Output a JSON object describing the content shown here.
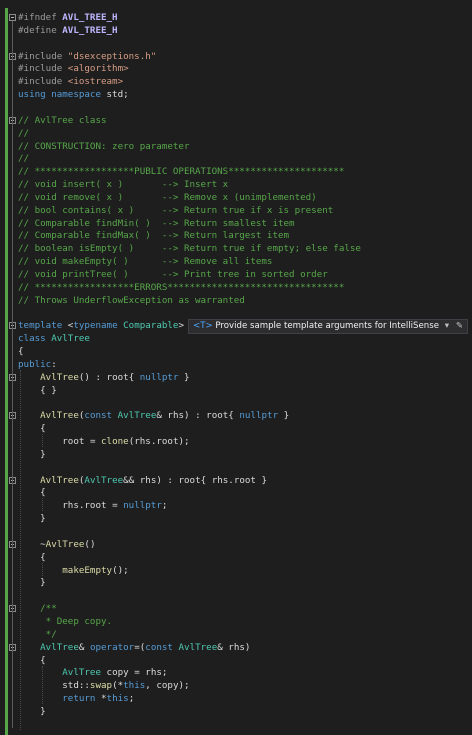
{
  "editor": {
    "lines": [
      {
        "segs": [
          [
            "pp",
            "#ifndef "
          ],
          [
            "macro",
            "AVL_TREE_H"
          ]
        ]
      },
      {
        "segs": [
          [
            "pp",
            "#define "
          ],
          [
            "macro",
            "AVL_TREE_H"
          ]
        ]
      },
      {
        "segs": []
      },
      {
        "segs": [
          [
            "pp",
            "#include "
          ],
          [
            "str",
            "\"dsexceptions.h\""
          ]
        ]
      },
      {
        "segs": [
          [
            "pp",
            "#include "
          ],
          [
            "str",
            "<algorithm>"
          ]
        ]
      },
      {
        "segs": [
          [
            "pp",
            "#include "
          ],
          [
            "str",
            "<iostream>"
          ]
        ]
      },
      {
        "segs": [
          [
            "kw",
            "using namespace "
          ],
          [
            "id",
            "std;"
          ]
        ]
      },
      {
        "segs": []
      },
      {
        "segs": [
          [
            "cm",
            "// AvlTree class"
          ]
        ]
      },
      {
        "segs": [
          [
            "cm",
            "//"
          ]
        ]
      },
      {
        "segs": [
          [
            "cm",
            "// CONSTRUCTION: zero parameter"
          ]
        ]
      },
      {
        "segs": [
          [
            "cm",
            "//"
          ]
        ]
      },
      {
        "segs": [
          [
            "cm",
            "// ******************PUBLIC OPERATIONS*********************"
          ]
        ]
      },
      {
        "segs": [
          [
            "cm",
            "// void insert( x )       --> Insert x"
          ]
        ]
      },
      {
        "segs": [
          [
            "cm",
            "// void remove( x )       --> Remove x (unimplemented)"
          ]
        ]
      },
      {
        "segs": [
          [
            "cm",
            "// bool contains( x )     --> Return true if x is present"
          ]
        ]
      },
      {
        "segs": [
          [
            "cm",
            "// Comparable findMin( )  --> Return smallest item"
          ]
        ]
      },
      {
        "segs": [
          [
            "cm",
            "// Comparable findMax( )  --> Return largest item"
          ]
        ]
      },
      {
        "segs": [
          [
            "cm",
            "// boolean isEmpty( )     --> Return true if empty; else false"
          ]
        ]
      },
      {
        "segs": [
          [
            "cm",
            "// void makeEmpty( )      --> Remove all items"
          ]
        ]
      },
      {
        "segs": [
          [
            "cm",
            "// void printTree( )      --> Print tree in sorted order"
          ]
        ]
      },
      {
        "segs": [
          [
            "cm",
            "// ******************ERRORS********************************"
          ]
        ]
      },
      {
        "segs": [
          [
            "cm",
            "// Throws UnderflowException as warranted"
          ]
        ]
      },
      {
        "segs": []
      },
      {
        "segs": [
          [
            "kw",
            "template "
          ],
          [
            "id",
            "<"
          ],
          [
            "kw",
            "typename "
          ],
          [
            "cls",
            "Comparable"
          ],
          [
            "id",
            ">"
          ]
        ]
      },
      {
        "segs": [
          [
            "kw",
            "class "
          ],
          [
            "cls",
            "AvlTree"
          ]
        ]
      },
      {
        "segs": [
          [
            "id",
            "{"
          ]
        ]
      },
      {
        "segs": [
          [
            "kw",
            "public"
          ],
          [
            "id",
            ":"
          ]
        ]
      },
      {
        "segs": [
          [
            "id",
            "    "
          ],
          [
            "fn",
            "AvlTree"
          ],
          [
            "id",
            "() : "
          ],
          [
            "fld",
            "root"
          ],
          [
            "id",
            "{ "
          ],
          [
            "kw",
            "nullptr"
          ],
          [
            "id",
            " }"
          ]
        ]
      },
      {
        "segs": [
          [
            "id",
            "    { }"
          ]
        ]
      },
      {
        "segs": []
      },
      {
        "segs": [
          [
            "id",
            "    "
          ],
          [
            "fn",
            "AvlTree"
          ],
          [
            "id",
            "("
          ],
          [
            "kw",
            "const "
          ],
          [
            "cls",
            "AvlTree"
          ],
          [
            "id",
            "& rhs) : "
          ],
          [
            "fld",
            "root"
          ],
          [
            "id",
            "{ "
          ],
          [
            "kw",
            "nullptr"
          ],
          [
            "id",
            " }"
          ]
        ]
      },
      {
        "segs": [
          [
            "id",
            "    {"
          ]
        ]
      },
      {
        "segs": [
          [
            "id",
            "        "
          ],
          [
            "fld",
            "root"
          ],
          [
            "id",
            " = "
          ],
          [
            "fn",
            "clone"
          ],
          [
            "id",
            "(rhs."
          ],
          [
            "fld",
            "root"
          ],
          [
            "id",
            ");"
          ]
        ]
      },
      {
        "segs": [
          [
            "id",
            "    }"
          ]
        ]
      },
      {
        "segs": []
      },
      {
        "segs": [
          [
            "id",
            "    "
          ],
          [
            "fn",
            "AvlTree"
          ],
          [
            "id",
            "("
          ],
          [
            "cls",
            "AvlTree"
          ],
          [
            "id",
            "&& rhs) : "
          ],
          [
            "fld",
            "root"
          ],
          [
            "id",
            "{ rhs."
          ],
          [
            "fld",
            "root"
          ],
          [
            "id",
            " }"
          ]
        ]
      },
      {
        "segs": [
          [
            "id",
            "    {"
          ]
        ]
      },
      {
        "segs": [
          [
            "id",
            "        rhs."
          ],
          [
            "fld",
            "root"
          ],
          [
            "id",
            " = "
          ],
          [
            "kw",
            "nullptr"
          ],
          [
            "id",
            ";"
          ]
        ]
      },
      {
        "segs": [
          [
            "id",
            "    }"
          ]
        ]
      },
      {
        "segs": []
      },
      {
        "segs": [
          [
            "id",
            "    ~"
          ],
          [
            "fn",
            "AvlTree"
          ],
          [
            "id",
            "()"
          ]
        ]
      },
      {
        "segs": [
          [
            "id",
            "    {"
          ]
        ]
      },
      {
        "segs": [
          [
            "id",
            "        "
          ],
          [
            "fn",
            "makeEmpty"
          ],
          [
            "id",
            "();"
          ]
        ]
      },
      {
        "segs": [
          [
            "id",
            "    }"
          ]
        ]
      },
      {
        "segs": []
      },
      {
        "segs": [
          [
            "cm",
            "    /**"
          ]
        ]
      },
      {
        "segs": [
          [
            "cm",
            "     * Deep copy."
          ]
        ]
      },
      {
        "segs": [
          [
            "cm",
            "     */"
          ]
        ]
      },
      {
        "segs": [
          [
            "id",
            "    "
          ],
          [
            "cls",
            "AvlTree"
          ],
          [
            "id",
            "& "
          ],
          [
            "kw",
            "operator"
          ],
          [
            "id",
            "=("
          ],
          [
            "kw",
            "const "
          ],
          [
            "cls",
            "AvlTree"
          ],
          [
            "id",
            "& rhs)"
          ]
        ]
      },
      {
        "segs": [
          [
            "id",
            "    {"
          ]
        ]
      },
      {
        "segs": [
          [
            "id",
            "        "
          ],
          [
            "cls",
            "AvlTree"
          ],
          [
            "id",
            " "
          ],
          [
            "fld",
            "copy"
          ],
          [
            "id",
            " = rhs;"
          ]
        ]
      },
      {
        "segs": [
          [
            "id",
            "        std::"
          ],
          [
            "fn",
            "swap"
          ],
          [
            "id",
            "(*"
          ],
          [
            "kw",
            "this"
          ],
          [
            "id",
            ", "
          ],
          [
            "fld",
            "copy"
          ],
          [
            "id",
            ");"
          ]
        ]
      },
      {
        "segs": [
          [
            "id",
            "        "
          ],
          [
            "kw",
            "return "
          ],
          [
            "id",
            "*"
          ],
          [
            "kw",
            "this"
          ],
          [
            "id",
            ";"
          ]
        ]
      },
      {
        "segs": [
          [
            "id",
            "    }"
          ]
        ]
      },
      {
        "segs": []
      }
    ]
  },
  "hint": {
    "tag": "<T>",
    "text": "Provide sample template arguments for IntelliSense",
    "arrow": "▾",
    "pen": "✎"
  }
}
